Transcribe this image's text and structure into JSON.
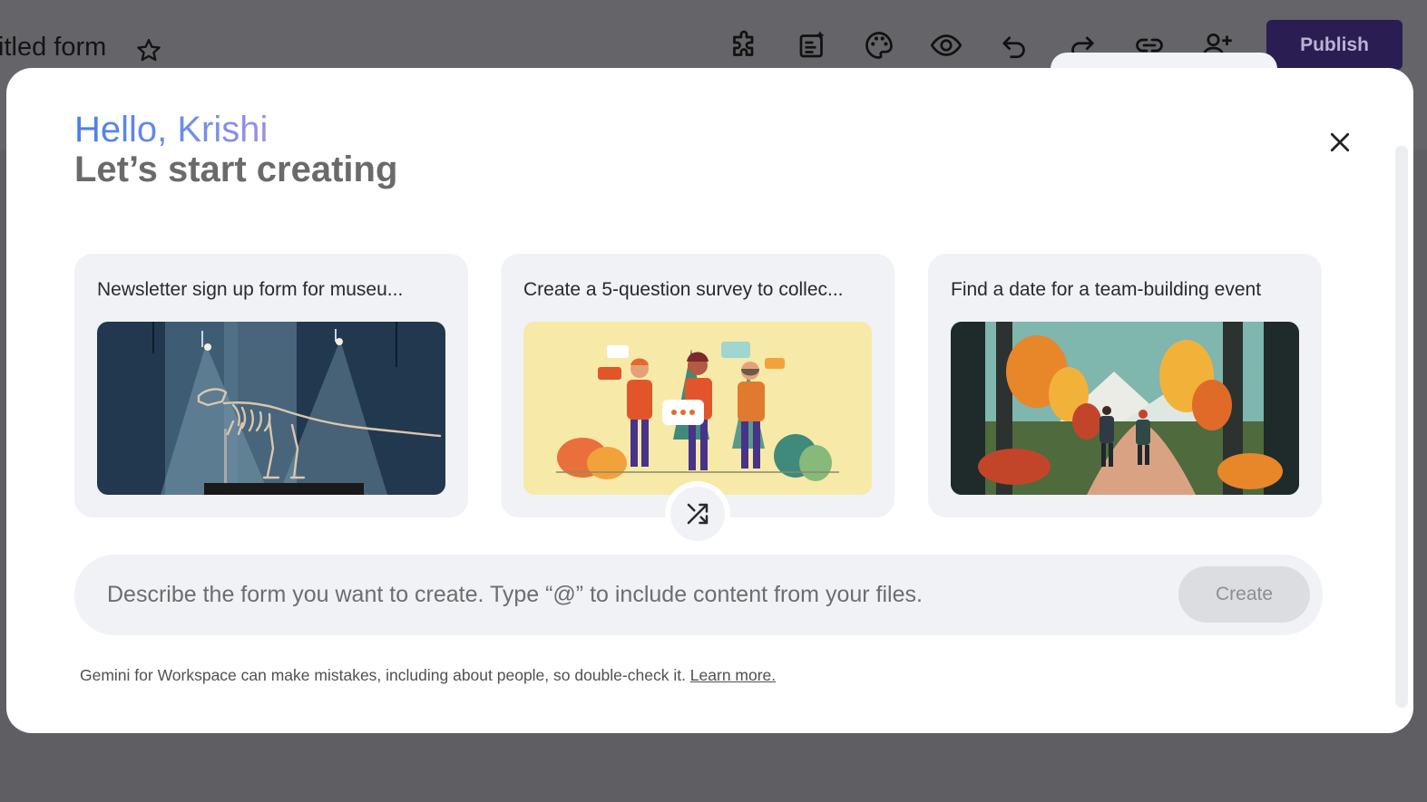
{
  "header": {
    "doc_title": "itled form",
    "publish_label": "Publish",
    "toolbar_icons": [
      "puzzle-icon",
      "form-sparkle-icon",
      "palette-icon",
      "eye-icon",
      "undo-icon",
      "redo-icon",
      "link-icon",
      "add-person-icon"
    ]
  },
  "modal": {
    "greeting": "Hello, Krishi",
    "subtitle": "Let’s start creating",
    "suggestions": [
      {
        "label": "Newsletter sign up form for museu...",
        "image": "museum-dinosaur-illustration"
      },
      {
        "label": "Create a 5-question survey to collec...",
        "image": "people-chat-illustration"
      },
      {
        "label": "Find a date for a team-building event",
        "image": "autumn-forest-hikers-illustration"
      }
    ],
    "prompt": {
      "placeholder": "Describe the form you want to create. Type “@” to include content from your files.",
      "value": "",
      "create_label": "Create"
    },
    "disclaimer": {
      "text": "Gemini for Workspace can make mistakes, including about people, so double-check it. ",
      "link": "Learn more."
    }
  },
  "colors": {
    "backdrop": "#5f5f63",
    "publish_bg": "#2a1d52",
    "greeting_gradient": [
      "#4a7fe6",
      "#9d8fe6"
    ],
    "card_bg": "#f0f2f6",
    "create_disabled": "#dcdde0"
  }
}
